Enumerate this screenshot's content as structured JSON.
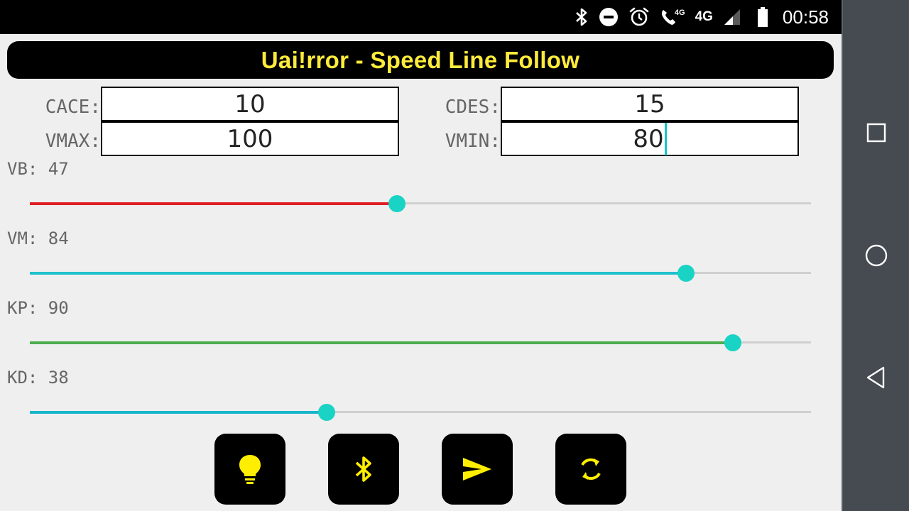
{
  "status_bar": {
    "icons": [
      "bluetooth-icon",
      "do-not-disturb-icon",
      "alarm-icon",
      "wifi-calling-4g-icon",
      "signal-4g-icon",
      "battery-icon"
    ],
    "call_network": "4G",
    "network": "4G",
    "time": "00:58"
  },
  "title": "Uai!rror - Speed Line Follow",
  "params": {
    "cace": {
      "label": "CACE:",
      "value": "10"
    },
    "cdes": {
      "label": "CDES:",
      "value": "15"
    },
    "vmax": {
      "label": "VMAX:",
      "value": "100"
    },
    "vmin": {
      "label": "VMIN:",
      "value": "80"
    }
  },
  "sliders": [
    {
      "label": "VB: 47",
      "value": 47,
      "color": "#e11d24"
    },
    {
      "label": "VM: 84",
      "value": 84,
      "color": "#22c0cc"
    },
    {
      "label": "KP: 90",
      "value": 90,
      "color": "#4caf50"
    },
    {
      "label": "KD: 38",
      "value": 38,
      "color": "#17b5c9"
    }
  ],
  "slider_max": 100,
  "actions": [
    {
      "name": "light-button",
      "icon": "lightbulb-icon"
    },
    {
      "name": "bluetooth-button",
      "icon": "bluetooth-icon"
    },
    {
      "name": "send-button",
      "icon": "send-icon"
    },
    {
      "name": "refresh-button",
      "icon": "refresh-icon"
    }
  ],
  "colors": {
    "accent": "#19d3c5",
    "title_text": "#ffeb3b",
    "icon_yellow": "#ffee00",
    "navbar": "#464b51"
  },
  "navigation": [
    "recents-button",
    "home-button",
    "back-button"
  ]
}
